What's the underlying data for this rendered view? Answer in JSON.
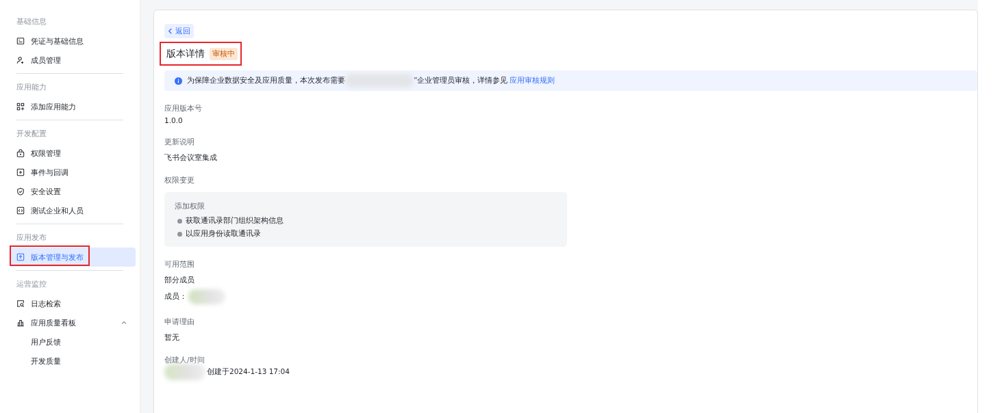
{
  "sidebar": {
    "sections": [
      {
        "title": "基础信息",
        "items": [
          {
            "label": "凭证与基础信息",
            "selected": false
          },
          {
            "label": "成员管理",
            "selected": false
          }
        ]
      },
      {
        "title": "应用能力",
        "items": [
          {
            "label": "添加应用能力",
            "selected": false
          }
        ]
      },
      {
        "title": "开发配置",
        "items": [
          {
            "label": "权限管理",
            "selected": false
          },
          {
            "label": "事件与回调",
            "selected": false
          },
          {
            "label": "安全设置",
            "selected": false
          },
          {
            "label": "测试企业和人员",
            "selected": false
          }
        ]
      },
      {
        "title": "应用发布",
        "items": [
          {
            "label": "版本管理与发布",
            "selected": true
          }
        ]
      },
      {
        "title": "运营监控",
        "items": [
          {
            "label": "日志检索",
            "selected": false
          },
          {
            "label": "应用质量看板",
            "selected": false,
            "expanded": true,
            "children": [
              {
                "label": "用户反馈",
                "selected": false
              },
              {
                "label": "开发质量",
                "selected": false
              }
            ]
          }
        ]
      }
    ]
  },
  "detail": {
    "back": "返回",
    "title": "版本详情",
    "status": "审核中",
    "notice": {
      "before": "为保障企业数据安全及应用质量，本次发布需要",
      "after": "”企业管理员审核，详情参见",
      "link": "应用审核规则"
    },
    "version": {
      "label": "应用版本号",
      "value": "1.0.0"
    },
    "notes": {
      "label": "更新说明",
      "value": "飞书会议室集成"
    },
    "permissions": {
      "label": "权限变更",
      "group": "添加权限",
      "items": [
        "获取通讯录部门组织架构信息",
        "以应用身份读取通讯录"
      ]
    },
    "scope": {
      "label": "可用范围",
      "value": "部分成员",
      "members_label": "成员："
    },
    "reason": {
      "label": "申请理由",
      "value": "暂无"
    },
    "creator": {
      "label": "创建人/时间",
      "value": "创建于2024-1-13 17:04"
    }
  }
}
